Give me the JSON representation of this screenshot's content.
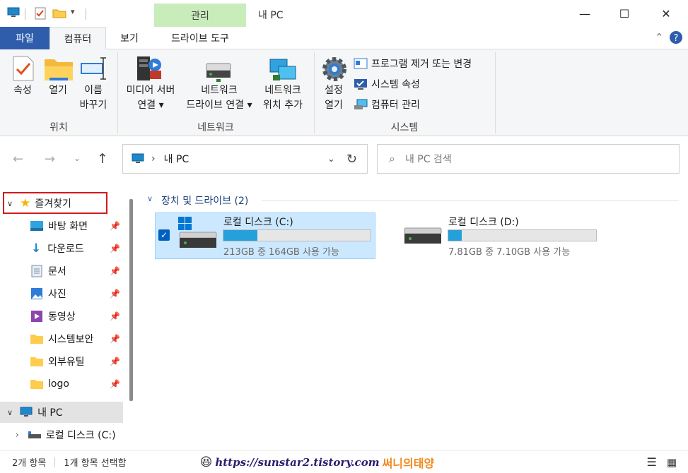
{
  "titlebar": {
    "context_tab": "관리",
    "title": "내 PC",
    "minimize": "—",
    "maximize": "☐",
    "close": "✕"
  },
  "tabs": [
    "파일",
    "컴퓨터",
    "보기",
    "드라이브 도구"
  ],
  "ribbon": {
    "location": {
      "group": "위치",
      "properties": "속성",
      "open": "열기",
      "rename_1": "이름",
      "rename_2": "바꾸기"
    },
    "network": {
      "group": "네트워크",
      "media_1": "미디어 서버",
      "media_2": "연결 ▾",
      "map_1": "네트워크",
      "map_2": "드라이브 연결 ▾",
      "addloc_1": "네트워크",
      "addloc_2": "위치 추가"
    },
    "system": {
      "group": "시스템",
      "settings_1": "설정",
      "settings_2": "열기",
      "uninstall": "프로그램 제거 또는 변경",
      "sysprops": "시스템 속성",
      "manage": "컴퓨터 관리"
    }
  },
  "address": {
    "path": "내 PC",
    "search_placeholder": "내 PC 검색"
  },
  "sidebar": {
    "favorites": "즐겨찾기",
    "items": [
      "바탕 화면",
      "다운로드",
      "문서",
      "사진",
      "동영상",
      "시스템보안",
      "외부유틸",
      "logo"
    ],
    "this_pc": "내 PC",
    "local_disk": "로컬 디스크 (C:)"
  },
  "content": {
    "section": "장치 및 드라이브 (2)",
    "drives": [
      {
        "name": "로컬 디스크 (C:)",
        "info": "213GB 중 164GB 사용 가능",
        "used_fraction": 0.23
      },
      {
        "name": "로컬 디스크 (D:)",
        "info": "7.81GB 중 7.10GB 사용 가능",
        "used_fraction": 0.09
      }
    ]
  },
  "status": {
    "count": "2개 항목",
    "selected": "1개 항목 선택함",
    "watermark": "https://sunstar2.tistory.com",
    "watermark_name": "써니의태양"
  },
  "colors": {
    "file_tab": "#2f5dac",
    "context_tab": "#c9ecbb",
    "selection": "#cce8ff",
    "bar_fill": "#26a0da",
    "highlight_box": "#d11a1a"
  }
}
